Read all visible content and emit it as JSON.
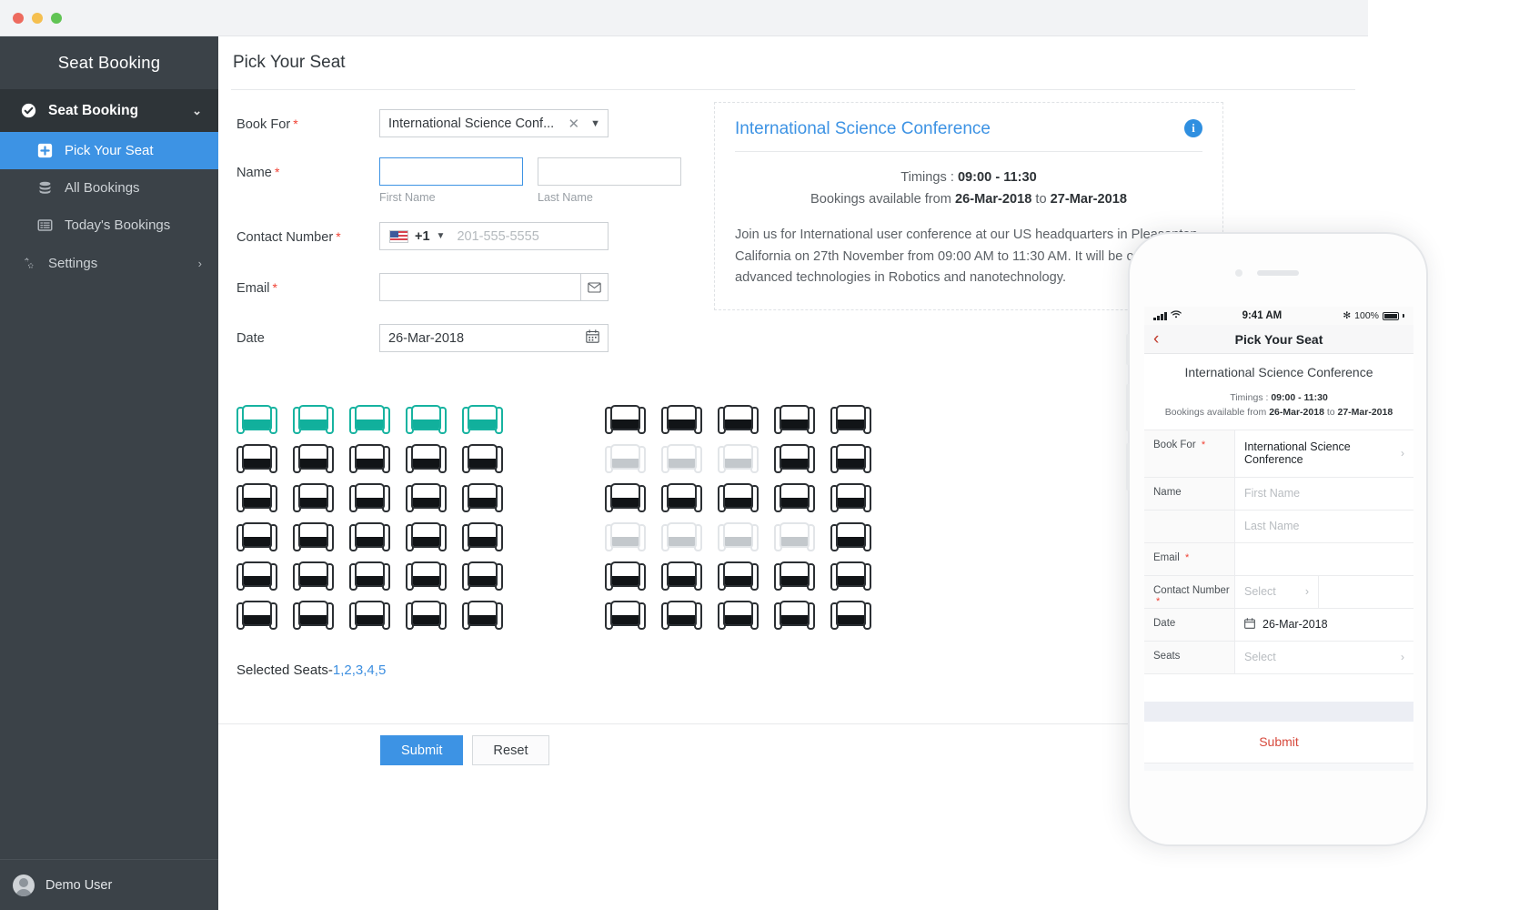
{
  "window": {
    "dots": [
      "close",
      "minimize",
      "maximize"
    ]
  },
  "sidebar": {
    "title": "Seat Booking",
    "group": {
      "label": "Seat Booking",
      "icon": "check-circle-icon",
      "chevron": "⌄"
    },
    "items": [
      {
        "label": "Pick Your Seat",
        "icon": "plus-square-icon",
        "active": true
      },
      {
        "label": "All Bookings",
        "icon": "database-icon",
        "active": false
      },
      {
        "label": "Today's Bookings",
        "icon": "list-card-icon",
        "active": false
      }
    ],
    "settings": {
      "label": "Settings",
      "icon": "gears-icon",
      "chevron": "›"
    },
    "user": {
      "name": "Demo User"
    }
  },
  "page": {
    "title": "Pick Your Seat"
  },
  "form": {
    "book_for": {
      "label": "Book For",
      "required": "*",
      "value": "International Science Conf...",
      "clear": "✕",
      "caret": "▼"
    },
    "name": {
      "label": "Name",
      "required": "*",
      "first_value": "",
      "first_hint": "First Name",
      "last_value": "",
      "last_hint": "Last Name"
    },
    "contact": {
      "label": "Contact Number",
      "required": "*",
      "country_code": "+1",
      "flag": "us-flag-icon",
      "placeholder": "201-555-5555",
      "value": ""
    },
    "email": {
      "label": "Email",
      "required": "*",
      "value": "",
      "icon": "envelope-icon"
    },
    "date": {
      "label": "Date",
      "value": "26-Mar-2018",
      "icon": "calendar-icon"
    }
  },
  "event": {
    "title": "International Science Conference",
    "info_icon": "i",
    "timings_label": "Timings : ",
    "timings_value": "09:00 - 11:30",
    "bookings_prefix": "Bookings available from ",
    "bookings_from": "26-Mar-2018",
    "bookings_mid": " to ",
    "bookings_to": "27-Mar-2018",
    "description": "Join us for International user conference at our US headquarters in Pleasanton, California on 27th November from 09:00 AM to 11:30 AM. It will be on advanced technologies in Robotics and nanotechnology."
  },
  "seats": {
    "left_block": [
      [
        "selected",
        "selected",
        "selected",
        "selected",
        "selected"
      ],
      [
        "available",
        "available",
        "available",
        "available",
        "available"
      ],
      [
        "available",
        "available",
        "available",
        "available",
        "available"
      ],
      [
        "available",
        "available",
        "available",
        "available",
        "available"
      ],
      [
        "available",
        "available",
        "available",
        "available",
        "available"
      ],
      [
        "available",
        "available",
        "available",
        "available",
        "available"
      ]
    ],
    "right_block": [
      [
        "available",
        "available",
        "available",
        "available",
        "available"
      ],
      [
        "disabled",
        "disabled",
        "disabled",
        "available",
        "available"
      ],
      [
        "available",
        "available",
        "available",
        "available",
        "available"
      ],
      [
        "disabled",
        "disabled",
        "disabled",
        "disabled",
        "available"
      ],
      [
        "available",
        "available",
        "available",
        "available",
        "available"
      ],
      [
        "available",
        "available",
        "available",
        "available",
        "available"
      ]
    ],
    "selected_label": "Selected Seats-",
    "selected_values": "1,2,3,4,5"
  },
  "actions": {
    "submit": "Submit",
    "reset": "Reset"
  },
  "phone": {
    "status": {
      "time": "9:41 AM",
      "battery": "100%",
      "bluetooth": "✻",
      "wifi": "wifi-icon",
      "signal": "signal-bars-icon"
    },
    "nav": {
      "back": "‹",
      "title": "Pick Your Seat"
    },
    "event": {
      "title": "International Science Conference",
      "timings_label": "Timings : ",
      "timings_value": "09:00 - 11:30",
      "bookings_prefix": "Bookings available from ",
      "bookings_from": "26-Mar-2018",
      "bookings_mid": " to ",
      "bookings_to": "27-Mar-2018"
    },
    "rows": [
      {
        "label": "Book For",
        "required": "*",
        "value": "International Science Conference",
        "placeholder": false,
        "arrow": "›"
      },
      {
        "label": "Name",
        "required": "",
        "value": "First Name",
        "placeholder": true,
        "arrow": ""
      },
      {
        "label": "",
        "required": "",
        "value": "Last Name",
        "placeholder": true,
        "arrow": ""
      },
      {
        "label": "Email",
        "required": "*",
        "value": "",
        "placeholder": false,
        "arrow": ""
      },
      {
        "label": "Contact Number",
        "required": "*",
        "value": "Select",
        "placeholder": true,
        "arrow": "›"
      },
      {
        "label": "Date",
        "required": "",
        "value": "26-Mar-2018",
        "placeholder": false,
        "arrow": "",
        "icon": "calendar-icon"
      },
      {
        "label": "Seats",
        "required": "",
        "value": "Select",
        "placeholder": true,
        "arrow": "›"
      }
    ],
    "submit": "Submit"
  },
  "colors": {
    "accent_blue": "#3d93e4",
    "sidebar_bg": "#3b4248",
    "sidebar_group_bg": "#2e3438",
    "seat_selected": "#11b09c",
    "required_red": "#f04134",
    "phone_submit_red": "#d74a3d"
  }
}
